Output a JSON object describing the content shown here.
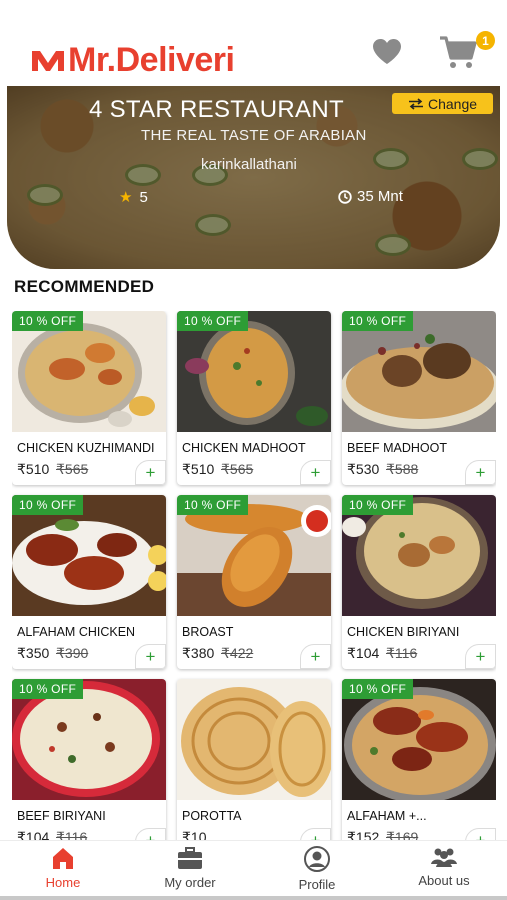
{
  "app": {
    "brand": "Mr.Deliveri",
    "brand_color": "#e8402f",
    "cart_count": "1"
  },
  "restaurant": {
    "name": "4 STAR RESTAURANT",
    "tagline": "THE REAL TASTE OF ARABIAN",
    "location": "karinkallathani",
    "change_label": "Change",
    "rating": "5",
    "delivery_time": "35 Mnt"
  },
  "section": {
    "title": "RECOMMENDED"
  },
  "products": [
    {
      "name": "CHICKEN KUZHIMANDI",
      "price": "₹510",
      "old_price": "₹565",
      "discount": "10 % OFF",
      "img": "mandi-plate"
    },
    {
      "name": "CHICKEN MADHOOT",
      "price": "₹510",
      "old_price": "₹565",
      "discount": "10 % OFF",
      "img": "madhoot-bowl"
    },
    {
      "name": "BEEF MADHOOT",
      "price": "₹530",
      "old_price": "₹588",
      "discount": "10 % OFF",
      "img": "beef-rice"
    },
    {
      "name": "ALFAHAM CHICKEN",
      "price": "₹350",
      "old_price": "₹390",
      "discount": "10 % OFF",
      "img": "grilled-chicken"
    },
    {
      "name": "BROAST",
      "price": "₹380",
      "old_price": "₹422",
      "discount": "10 % OFF",
      "img": "fried-drumsticks"
    },
    {
      "name": "CHICKEN BIRIYANI",
      "price": "₹104",
      "old_price": "₹116",
      "discount": "10 % OFF",
      "img": "biriyani-bowl"
    },
    {
      "name": "BEEF BIRIYANI",
      "price": "₹104",
      "old_price": "₹116",
      "discount": "10 % OFF",
      "img": "beef-biriyani"
    },
    {
      "name": "POROTTA",
      "price": "₹10",
      "old_price": "",
      "discount": "",
      "img": "porotta"
    },
    {
      "name": "ALFAHAM +...",
      "price": "₹152",
      "old_price": "₹169",
      "discount": "10 % OFF",
      "img": "alfaham-rice"
    }
  ],
  "tabs": [
    {
      "label": "Home",
      "icon": "home-icon",
      "active": true
    },
    {
      "label": "My order",
      "icon": "briefcase-icon",
      "active": false
    },
    {
      "label": "Profile",
      "icon": "profile-icon",
      "active": false
    },
    {
      "label": "About us",
      "icon": "group-icon",
      "active": false
    }
  ],
  "colors": {
    "accent": "#e8402f",
    "discount": "#2e9d35",
    "change_button": "#f7c21b",
    "badge": "#f5b400"
  }
}
